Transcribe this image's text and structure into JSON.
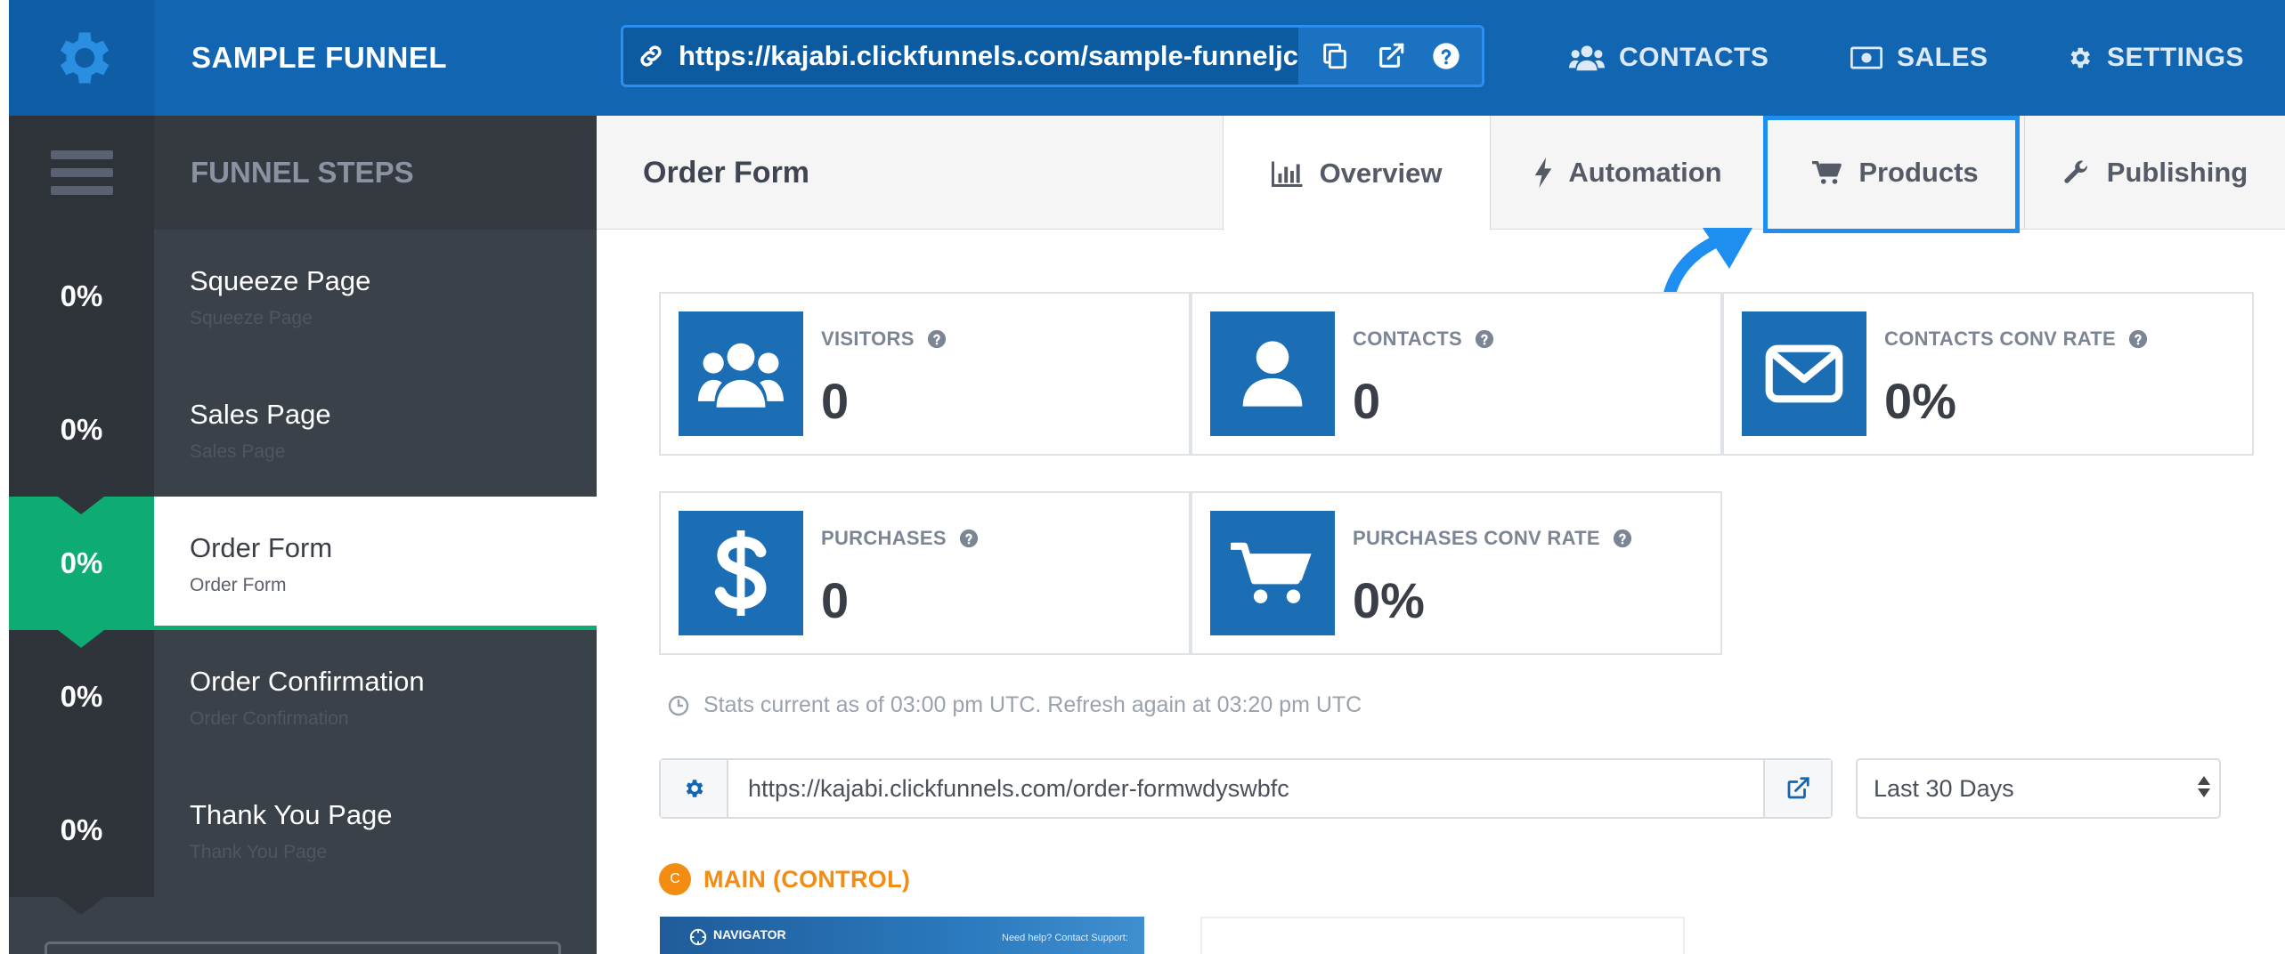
{
  "header": {
    "title": "SAMPLE FUNNEL",
    "url": "https://kajabi.clickfunnels.com/sample-funneljc",
    "nav": [
      "CONTACTS",
      "SALES",
      "SETTINGS"
    ]
  },
  "sidebar": {
    "title": "FUNNEL STEPS",
    "steps": [
      {
        "percent": "0%",
        "name": "Squeeze Page",
        "sub": "Squeeze Page"
      },
      {
        "percent": "0%",
        "name": "Sales Page",
        "sub": "Sales Page"
      },
      {
        "percent": "0%",
        "name": "Order Form",
        "sub": "Order Form"
      },
      {
        "percent": "0%",
        "name": "Order Confirmation",
        "sub": "Order Confirmation"
      },
      {
        "percent": "0%",
        "name": "Thank You Page",
        "sub": "Thank You Page"
      }
    ]
  },
  "main": {
    "page_title": "Order Form",
    "tabs": [
      "Overview",
      "Automation",
      "Products",
      "Publishing"
    ],
    "stats": [
      {
        "label": "VISITORS",
        "value": "0",
        "icon": "users-icon"
      },
      {
        "label": "CONTACTS",
        "value": "0",
        "icon": "user-icon"
      },
      {
        "label": "CONTACTS CONV RATE",
        "value": "0%",
        "icon": "envelope-icon"
      },
      {
        "label": "PURCHASES",
        "value": "0",
        "icon": "dollar-icon"
      },
      {
        "label": "PURCHASES CONV RATE",
        "value": "0%",
        "icon": "cart-icon"
      }
    ],
    "stats_note": "Stats current as of 03:00 pm UTC. Refresh again at 03:20 pm UTC",
    "page_url": "https://kajabi.clickfunnels.com/order-formwdyswbfc",
    "date_range": "Last 30 Days",
    "variant_badge": "C",
    "variant_name": "MAIN (CONTROL)",
    "thumbnail": {
      "brand": "NAVIGATOR",
      "help": "Need help? Contact Support:"
    }
  },
  "colors": {
    "header_blue": "#1266b1",
    "accent_green": "#0eab72",
    "stat_icon_blue": "#1b6db4",
    "highlight_blue": "#1e8ff0",
    "variant_orange": "#f28c12"
  }
}
